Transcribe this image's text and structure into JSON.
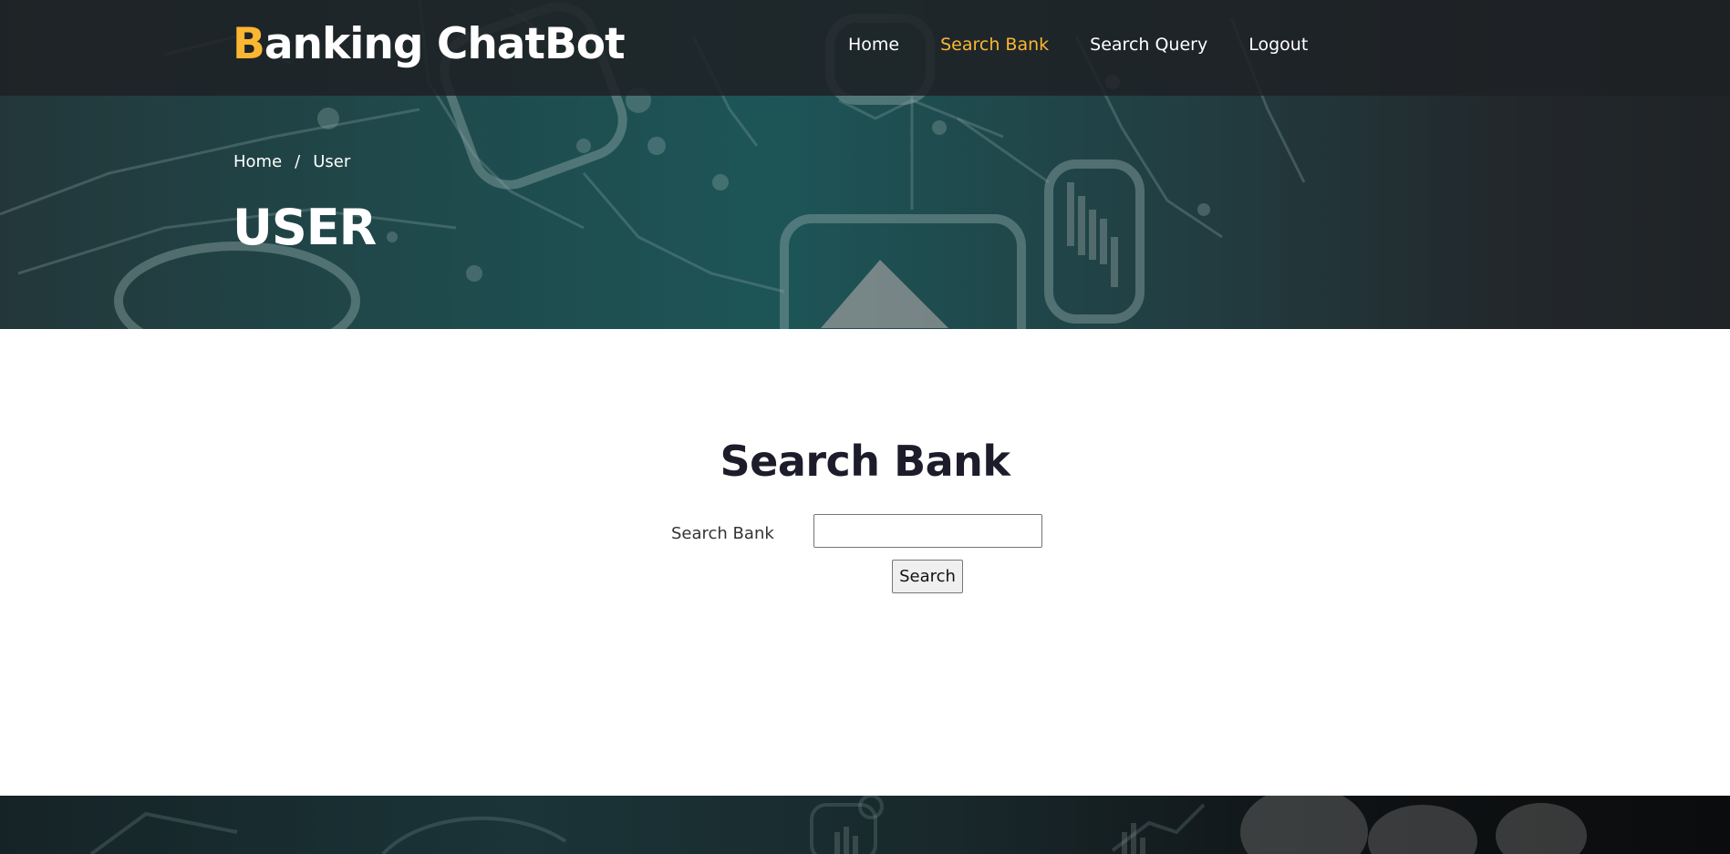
{
  "brand": {
    "first_letter": "B",
    "rest": "anking ChatBot",
    "accent_color": "#fbb632"
  },
  "nav": {
    "items": [
      {
        "label": "Home",
        "active": false
      },
      {
        "label": "Search Bank",
        "active": true
      },
      {
        "label": "Search Query",
        "active": false
      },
      {
        "label": "Logout",
        "active": false
      }
    ]
  },
  "breadcrumb": {
    "home": "Home",
    "separator": "/",
    "current": "User"
  },
  "page": {
    "title": "USER"
  },
  "search": {
    "heading": "Search Bank",
    "label": "Search Bank",
    "input_value": "",
    "button_label": "Search"
  }
}
